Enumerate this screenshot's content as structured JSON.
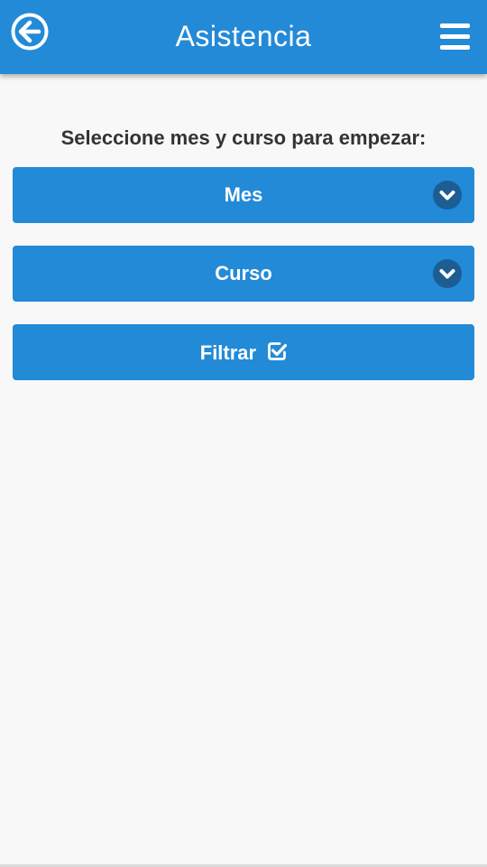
{
  "header": {
    "title": "Asistencia",
    "back_icon": "arrow-circle-left-icon",
    "menu_icon": "hamburger-menu-icon",
    "color": "#238ad8"
  },
  "main": {
    "prompt": "Seleccione mes y curso para empezar:",
    "month_select": {
      "label": "Mes",
      "icon": "chevron-down-icon"
    },
    "course_select": {
      "label": "Curso",
      "icon": "chevron-down-icon"
    },
    "filter_button": {
      "label": "Filtrar",
      "icon": "check-square-icon"
    }
  },
  "colors": {
    "accent": "#238ad8",
    "chevron_bg": "#1c5d93",
    "text": "#333333",
    "background": "#f8f8f8"
  }
}
